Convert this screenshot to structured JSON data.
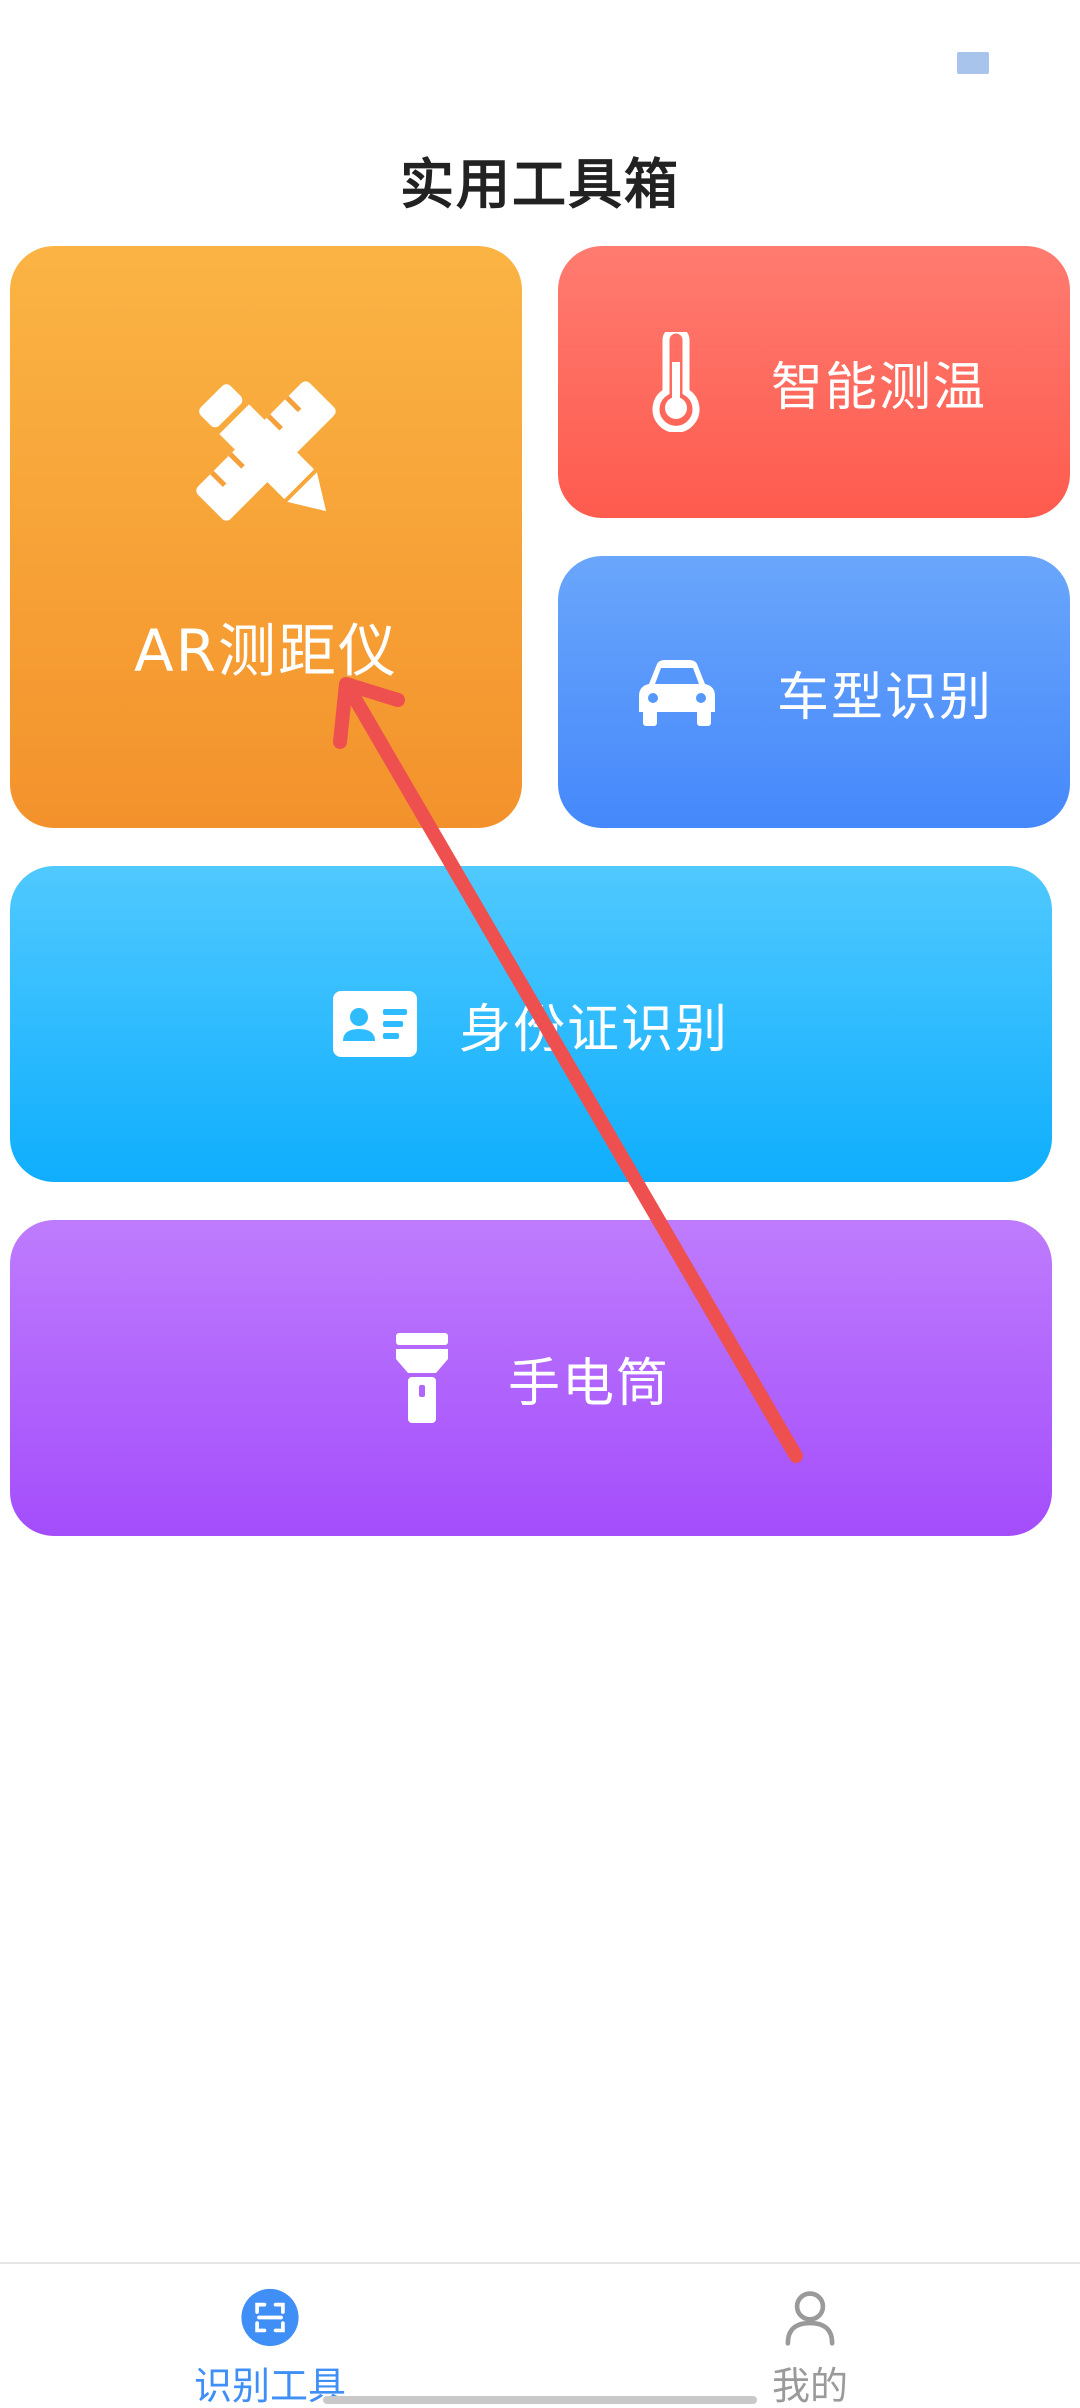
{
  "header": {
    "title": "实用工具箱"
  },
  "tools": {
    "ar": {
      "label": "AR测距仪",
      "icon": "pencil-ruler-icon"
    },
    "temperature": {
      "label": "智能测温",
      "icon": "thermometer-icon"
    },
    "car": {
      "label": "车型识别",
      "icon": "car-icon"
    },
    "idcard": {
      "label": "身份证识别",
      "icon": "id-card-icon"
    },
    "flashlight": {
      "label": "手电筒",
      "icon": "flashlight-icon"
    }
  },
  "tabbar": {
    "tools": {
      "label": "识别工具",
      "icon": "scan-icon",
      "active": true
    },
    "mine": {
      "label": "我的",
      "icon": "user-icon",
      "active": false
    }
  },
  "colors": {
    "ar_card": "#f6a03a",
    "temperature_card": "#fe6a5e",
    "car_card": "#5597fb",
    "idcard_card": "#2ebcfe",
    "flashlight_card": "#b065fc",
    "active_tab": "#3f8ff7",
    "inactive_tab": "#9a9a9a",
    "annotation_arrow": "#ee5050"
  }
}
